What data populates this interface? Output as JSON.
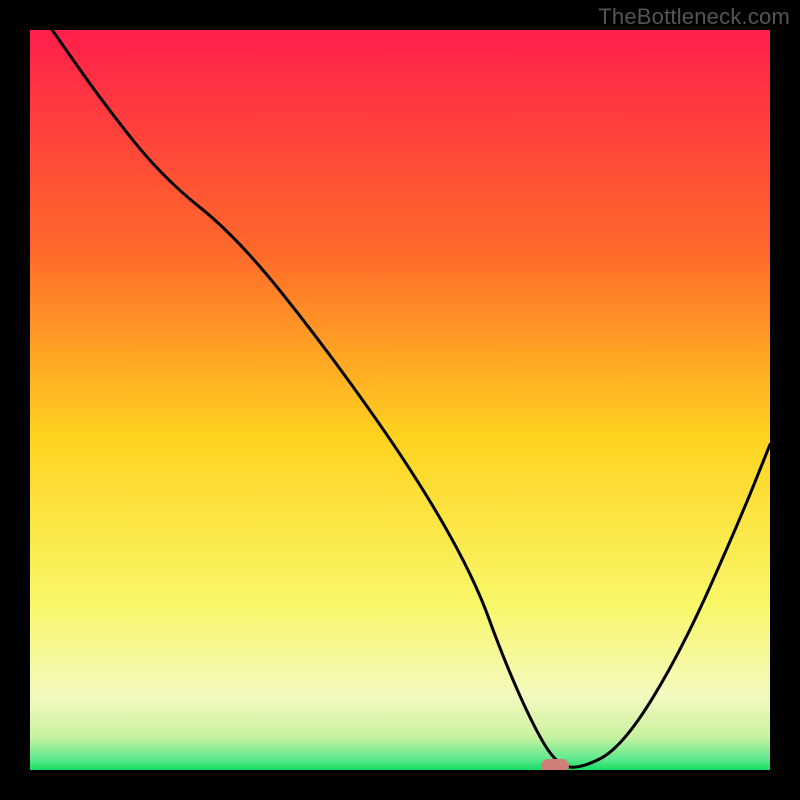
{
  "watermark": "TheBottleneck.com",
  "colors": {
    "top": "#ff1f4b",
    "mid_upper": "#ff8a2a",
    "mid": "#ffd31f",
    "mid_lower": "#f6f55e",
    "pale_green": "#d6f7a8",
    "green": "#1fe36a",
    "marker": "#cf7f7a",
    "curve": "#000000",
    "frame": "#000000"
  },
  "chart_data": {
    "type": "line",
    "title": "",
    "xlabel": "",
    "ylabel": "",
    "xlim": [
      0,
      100
    ],
    "ylim": [
      0,
      100
    ],
    "series": [
      {
        "name": "bottleneck-curve",
        "x": [
          3,
          10,
          18,
          28,
          40,
          52,
          60,
          64,
          68,
          71,
          74,
          80,
          88,
          96,
          100
        ],
        "y": [
          100,
          90,
          80,
          72,
          57,
          40,
          26,
          15,
          6,
          1,
          0,
          3,
          16,
          34,
          44
        ]
      }
    ],
    "marker": {
      "x": 71,
      "y": 0.5,
      "label": "optimal-point"
    },
    "gradient_stops": [
      {
        "offset": 0,
        "color": "#ff1f4b"
      },
      {
        "offset": 0.3,
        "color": "#ff6a2a"
      },
      {
        "offset": 0.55,
        "color": "#ffd31f"
      },
      {
        "offset": 0.78,
        "color": "#f8f86a"
      },
      {
        "offset": 0.9,
        "color": "#f4f9c0"
      },
      {
        "offset": 0.955,
        "color": "#c9f2a0"
      },
      {
        "offset": 0.985,
        "color": "#5fe990"
      },
      {
        "offset": 1.0,
        "color": "#17dc60"
      }
    ]
  }
}
